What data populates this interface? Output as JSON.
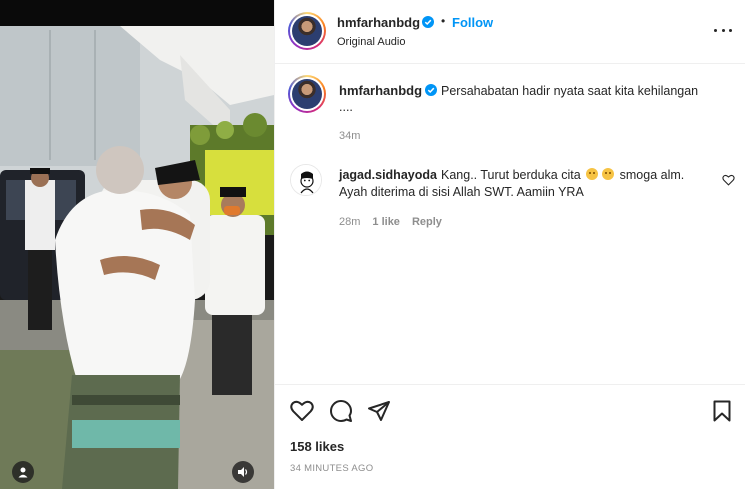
{
  "post": {
    "author": "hmfarhanbdg",
    "follow_label": "Follow",
    "separator": "•",
    "audio": "Original Audio",
    "caption": "Persahabatan hadir nyata saat kita kehilangan",
    "caption_cont": "....",
    "caption_time": "34m",
    "likes": "158 likes",
    "timestamp": "34 MINUTES AGO"
  },
  "comment": {
    "user": "jagad.sidhayoda",
    "text_part1": "Kang.. Turut berduka cita",
    "text_part2": "smoga alm.",
    "text_line2": "Ayah diterima di sisi Allah SWT. Aamiin YRA",
    "time": "28m",
    "likes": "1 like",
    "reply": "Reply"
  },
  "icons": {
    "verified": "verified-badge-icon",
    "more": "more-options-icon",
    "like": "heart-icon",
    "comment": "comment-bubble-icon",
    "share": "paper-plane-icon",
    "save": "bookmark-icon",
    "media_user": "user-tag-icon",
    "media_audio": "speaker-icon"
  },
  "colors": {
    "follow": "#0095f6",
    "verified": "#0095f6",
    "muted": "#8e8e8e",
    "text": "#262626"
  }
}
